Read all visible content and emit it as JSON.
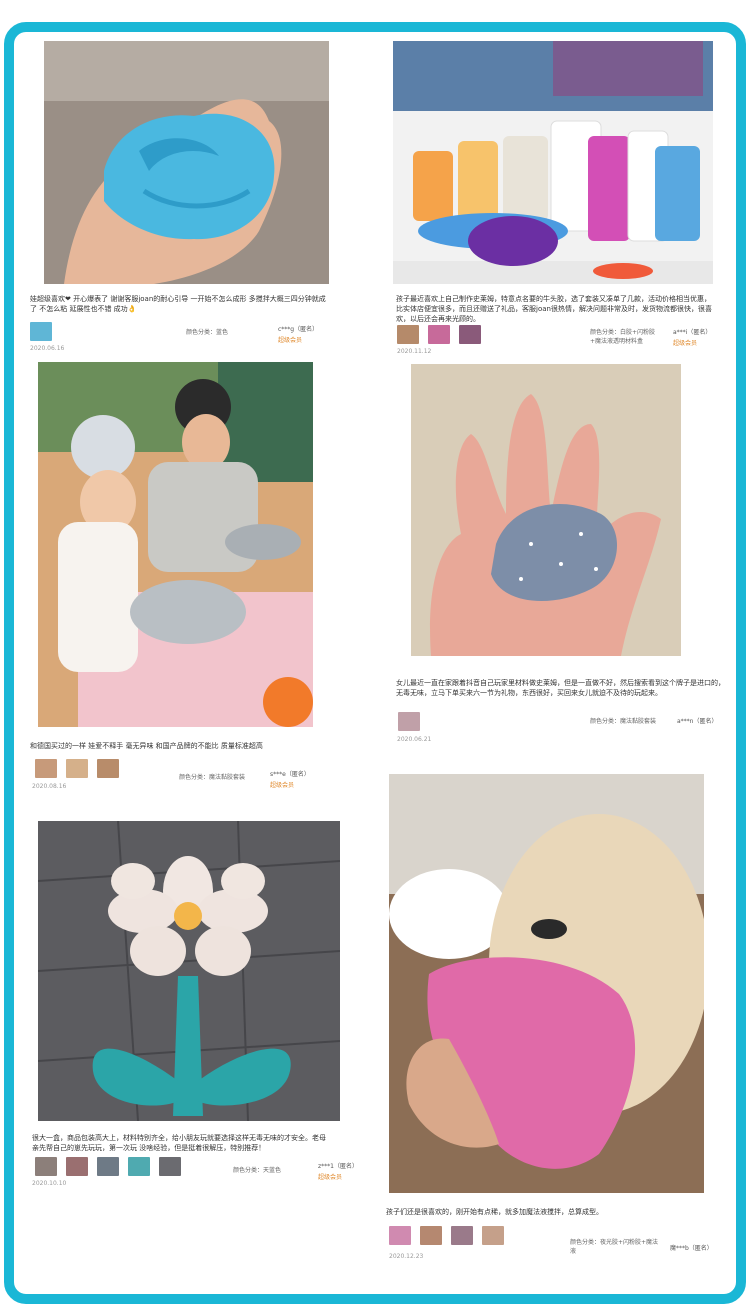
{
  "reviews": [
    {
      "text": "娃超级喜欢❤ 开心爆表了 谢谢客服joan的耐心引导 一开始不怎么成形 多搅拌大概三四分钟就成了 不怎么粘 延展性也不错 成功👌",
      "color_label": "颜色分类：蓝色",
      "user": "c***g（匿名）",
      "member": "超级会员",
      "date": "2020.06.16"
    },
    {
      "text": "孩子最近喜欢上自己制作史莱姆，特意点名要的牛头胶，选了套装又凑单了几款，活动价格相当优惠，比实体店便宜很多，而且还赠送了礼品，客服joan很热情，解决问题非常及时，发货物流都很快，很喜欢，以后还会再来光顾的。",
      "color_label": "颜色分类：白胶+闪粉胶+魔法液透明材料盒",
      "user": "a***i（匿名）",
      "member": "超级会员",
      "date": "2020.11.12"
    },
    {
      "text": "和德国买过的一样 娃爱不释手 毫无异味 和国产品牌的不能比 质量标准超高",
      "color_label": "颜色分类：魔法黏胶套装",
      "user": "s***e（匿名）",
      "member": "超级会员",
      "date": "2020.08.16"
    },
    {
      "text": "女儿最近一直在家跟着抖音自己玩家里材料做史莱姆，但是一直做不好，然后搜索看到这个牌子是进口的，无毒无味，立马下单买来六一节为礼物，东西很好，买回来女儿就迫不及待的玩起来。",
      "color_label": "颜色分类：魔法黏胶套装",
      "user": "a***n（匿名）",
      "member": "",
      "date": "2020.06.21"
    },
    {
      "text": "很大一盒，商品包装高大上，材料特别齐全，给小朋友玩就要选择这样无毒无味的才安全。老母亲先帮自己的崽先玩玩，第一次玩 没啥经验，但是挺着很解压，特别推荐！",
      "color_label": "颜色分类：天蓝色",
      "user": "z***1（匿名）",
      "member": "超级会员",
      "date": "2020.10.10"
    },
    {
      "text": "孩子们还是很喜欢的，刚开始有点稀，就多加魔法液搅拌，总算成型。",
      "color_label": "颜色分类：夜光胶+闪粉胶+魔法液",
      "user": "魔***b（匿名）",
      "member": "",
      "date": "2020.12.23"
    }
  ],
  "icons": {
    "photos": [
      "blue-slime-hand-photo",
      "elmers-glue-bottles-photo",
      "kids-making-slime-photo",
      "glitter-slime-hand-photo",
      "slime-flower-photo",
      "dog-pink-slime-photo"
    ]
  },
  "colors": {
    "frame_border": "#1ab7d6",
    "member": "#e08a2e"
  }
}
